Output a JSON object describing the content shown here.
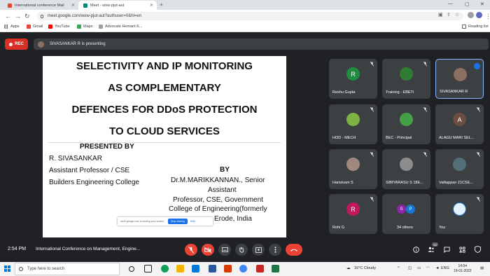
{
  "browser": {
    "tabs": [
      {
        "title": "International conference Mail"
      },
      {
        "title": "Meet - wow-pjut-aut"
      }
    ],
    "url": "meet.google.com/wow-pjut-aut?authuser=0&hl=en",
    "bookmarks": [
      {
        "label": "Apps"
      },
      {
        "label": "Gmail"
      },
      {
        "label": "YouTube"
      },
      {
        "label": "Maps"
      },
      {
        "label": "Advocate Hemant K..."
      }
    ],
    "reading_list": "Reading list"
  },
  "meet": {
    "rec_label": "REC",
    "presenting_text": "SIVASANKAR R is presenting",
    "slide": {
      "title_lines": [
        "SELECTIVITY AND IP MONITORING",
        "AS COMPLEMENTARY",
        "DEFENCES FOR DDoS PROTECTION",
        "TO CLOUD SERVICES"
      ],
      "presented_by": "PRESENTED BY",
      "author_name": "R. SIVASANKAR",
      "author_role": "Assistant Professor / CSE",
      "author_college": "Builders Engineering  College",
      "by": "BY",
      "guide_lines": [
        "Dr.M.MARIKKANNAN., Senior",
        "Assistant",
        "Professor, CSE, Government",
        "College of Engineering(formerly",
        "Erode,  India"
      ]
    },
    "share_bar": {
      "text": "meet.google.com is sharing your screen.",
      "stop": "Stop sharing",
      "hide": "Hide"
    },
    "participants": [
      {
        "name": "Reshu Gupta",
        "initial": "R",
        "color": "#1e8e3e"
      },
      {
        "name": "Training - EBETi",
        "initial": "",
        "color": "#2e7d32"
      },
      {
        "name": "SIVASANKAR R",
        "initial": "",
        "color": "#8d6e63"
      },
      {
        "name": "HOD - MECH",
        "initial": "",
        "color": "#7cb342"
      },
      {
        "name": "BEC - Principal",
        "initial": "",
        "color": "#43a047"
      },
      {
        "name": "ALAGU MARI SEL...",
        "initial": "A",
        "color": "#6d4c41"
      },
      {
        "name": "Harisivam S",
        "initial": "",
        "color": "#a1887f"
      },
      {
        "name": "SIBIYARASU S 18E...",
        "initial": "",
        "color": "#8d8d8d"
      },
      {
        "name": "Valliappan 21CSE...",
        "initial": "",
        "color": "#546e7a"
      },
      {
        "name": "Rohi G",
        "initial": "R",
        "color": "#c2185b"
      },
      {
        "name": "34 others",
        "initial": "",
        "color": ""
      },
      {
        "name": "You",
        "initial": "",
        "color": "#e3f2fd"
      }
    ],
    "others_avatars": [
      "S",
      "P"
    ],
    "time": "2:54 PM",
    "meeting_name": "International Conference on Management, Engine...",
    "people_count": "46"
  },
  "taskbar": {
    "search_placeholder": "Type here to search",
    "weather": "16°C  Cloudy",
    "lang": "ENG",
    "time": "14:54",
    "date": "19-01-2022"
  }
}
